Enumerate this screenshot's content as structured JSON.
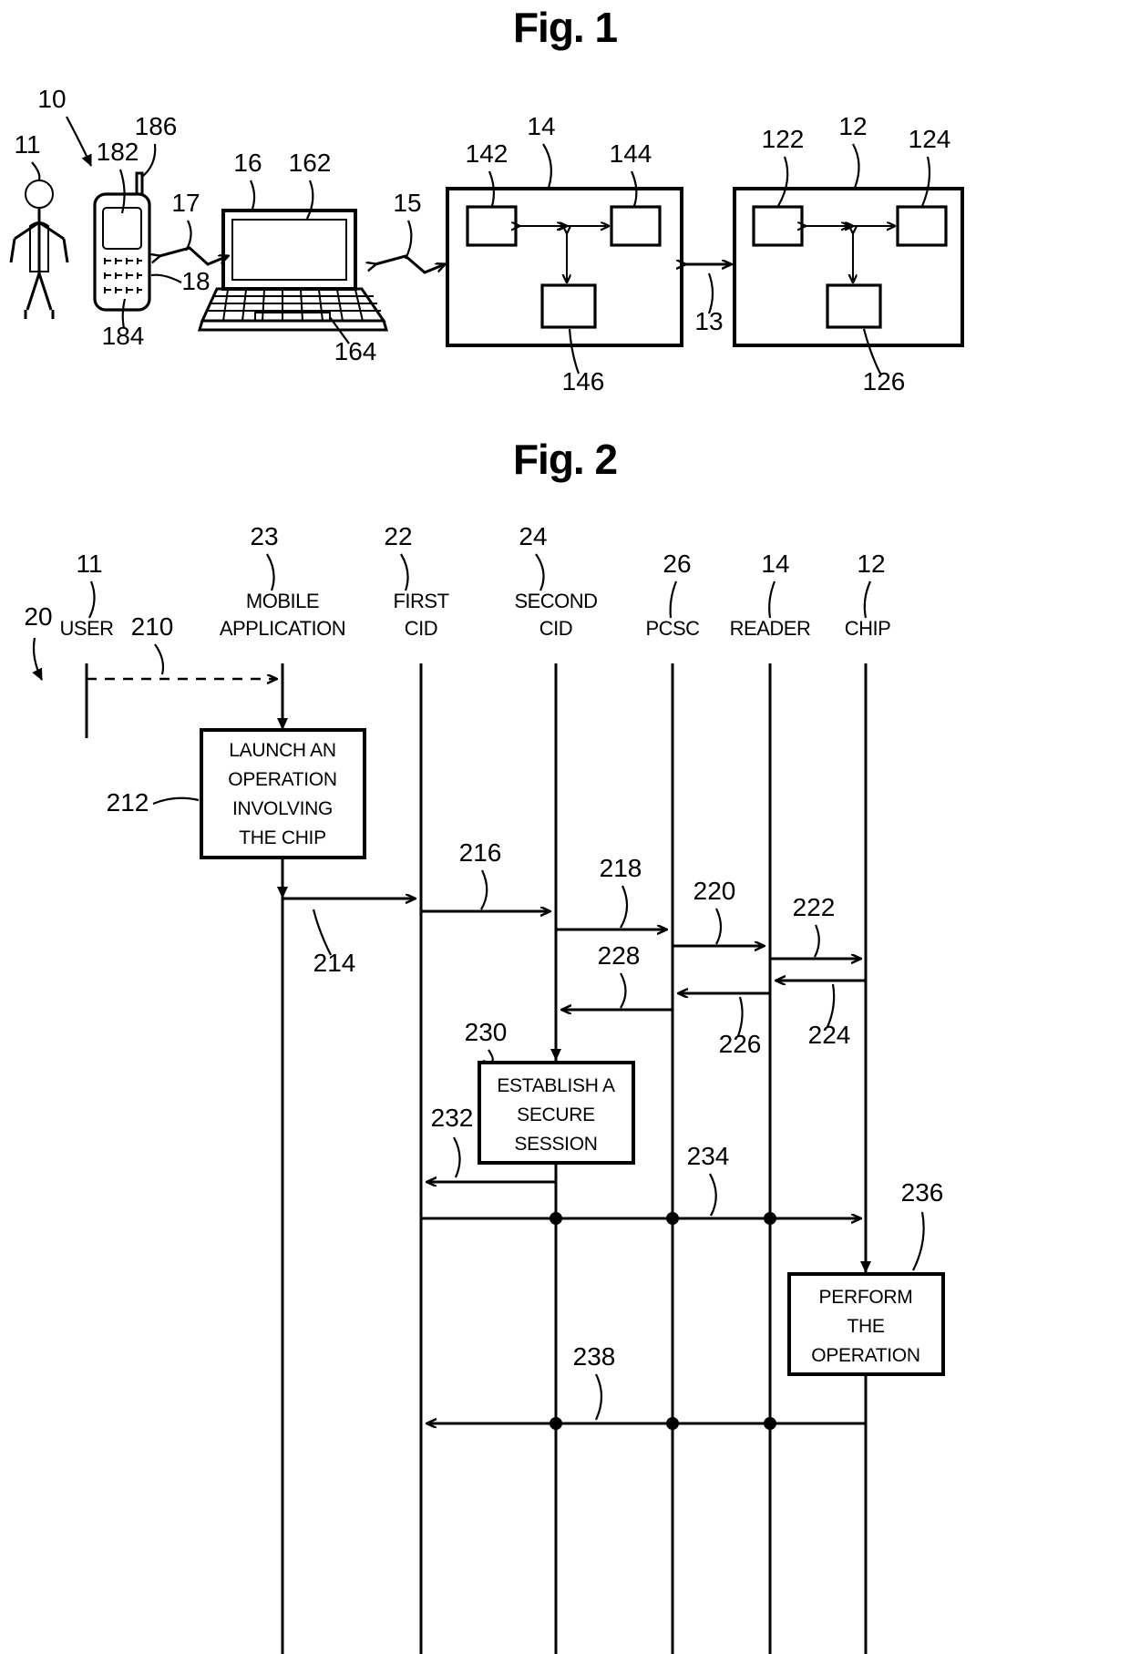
{
  "figures": [
    {
      "id": "fig1",
      "title": "Fig. 1",
      "refs": {
        "system": "10",
        "user": "11",
        "chip": "12",
        "link_13": "13",
        "reader": "14",
        "link_15": "15",
        "terminal": "16",
        "link_17": "17",
        "keypad_18": "18",
        "phone_screen": "182",
        "phone_keypad": "184",
        "phone_antenna": "186",
        "terminal_screen": "162",
        "terminal_keyboard": "164",
        "chip_block_1": "122",
        "chip_block_2": "124",
        "chip_block_3": "126",
        "reader_block_1": "142",
        "reader_block_2": "144",
        "reader_block_3": "146"
      }
    },
    {
      "id": "fig2",
      "title": "Fig. 2",
      "flow_ref": "20",
      "lifelines": [
        {
          "ref": "11",
          "label_line1": "USER",
          "label_line2": ""
        },
        {
          "ref": "23",
          "label_line1": "MOBILE",
          "label_line2": "APPLICATION"
        },
        {
          "ref": "22",
          "label_line1": "FIRST",
          "label_line2": "CID"
        },
        {
          "ref": "24",
          "label_line1": "SECOND",
          "label_line2": "CID"
        },
        {
          "ref": "26",
          "label_line1": "PCSC",
          "label_line2": ""
        },
        {
          "ref": "14",
          "label_line1": "READER",
          "label_line2": ""
        },
        {
          "ref": "12",
          "label_line1": "CHIP",
          "label_line2": ""
        }
      ],
      "process_boxes": [
        {
          "ref": "212",
          "lines": [
            "LAUNCH AN",
            "OPERATION",
            "INVOLVING",
            "THE CHIP"
          ]
        },
        {
          "ref": "230",
          "lines": [
            "ESTABLISH A",
            "SECURE",
            "SESSION"
          ]
        },
        {
          "ref": "236",
          "lines": [
            "PERFORM",
            "THE",
            "OPERATION"
          ]
        }
      ],
      "message_refs": [
        "210",
        "214",
        "216",
        "218",
        "220",
        "222",
        "224",
        "226",
        "228",
        "232",
        "234",
        "238"
      ]
    }
  ]
}
